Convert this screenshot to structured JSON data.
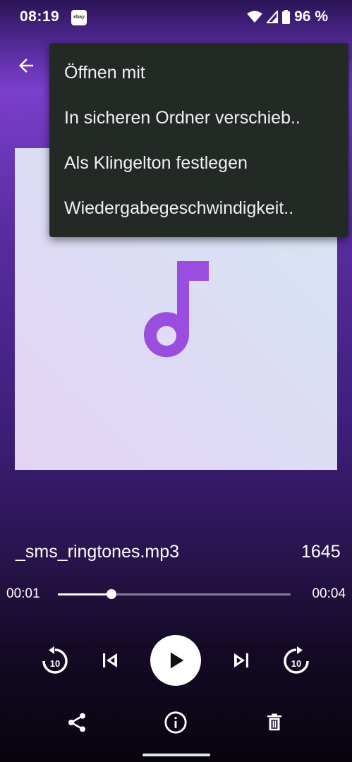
{
  "status_bar": {
    "time": "08:19",
    "notification_icon": "ebay-icon",
    "ebay_text": "ebay",
    "battery_text": "96 %"
  },
  "toolbar": {
    "back_icon": "arrow-left-icon"
  },
  "menu": {
    "items": [
      {
        "label": "Öffnen mit"
      },
      {
        "label": "In sicheren Ordner verschieb.."
      },
      {
        "label": "Als Klingelton festlegen"
      },
      {
        "label": "Wiedergabegeschwindigkeit.."
      }
    ]
  },
  "track": {
    "file_name": "_sms_ringtones.mp3",
    "file_size": "1645",
    "time_current": "00:01",
    "time_total": "00:04",
    "progress": 0.23
  },
  "controls": {
    "rewind_label": "10",
    "forward_label": "10"
  },
  "colors": {
    "accent": "#9a4ee0",
    "menu_bg": "#232a26"
  }
}
